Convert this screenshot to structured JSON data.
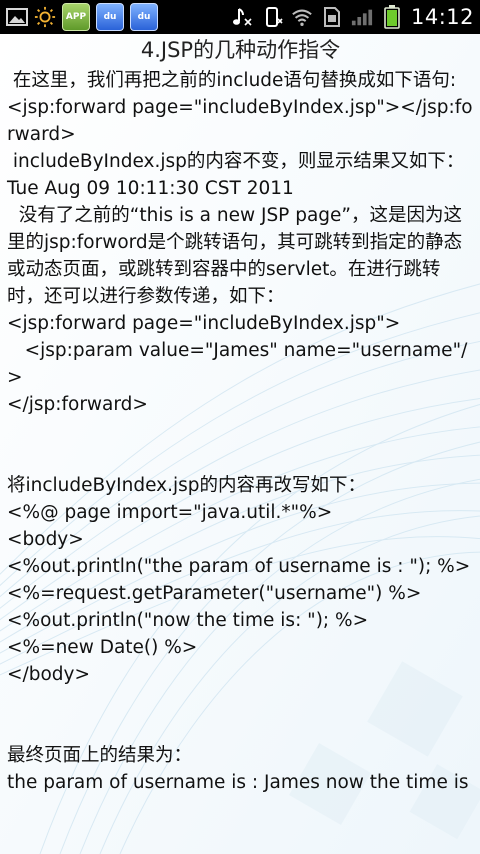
{
  "status_bar": {
    "time": "14:12",
    "left_icons": [
      {
        "icon": "gallery-icon"
      },
      {
        "icon": "brightness-icon"
      },
      {
        "icon": "app-store-icon",
        "label": "APP"
      },
      {
        "icon": "baidu-icon",
        "label": "du"
      },
      {
        "icon": "baidu-icon",
        "label": "du"
      }
    ],
    "right_icons": [
      "music-icon",
      "vibrate-icon",
      "wifi-icon",
      "sim-icon",
      "signal-icon",
      "battery-icon"
    ]
  },
  "article": {
    "title": "4.JSP的几种动作指令",
    "p1": " 在这里，我们再把之前的include语句替换成如下语句:",
    "code1": "<jsp:forward page=\"includeByIndex.jsp\"></jsp:forward>",
    "p2": " includeByIndex.jsp的内容不变，则显示结果又如下：",
    "date_line": "Tue Aug 09 10:11:30 CST 2011",
    "p3": "  没有了之前的“this is a new JSP page”，这是因为这里的jsp:forword是个跳转语句，其可跳转到指定的静态或动态页面，或跳转到容器中的servlet。在进行跳转时，还可以进行参数传递，如下：",
    "code2_l1": "<jsp:forward page=\"includeByIndex.jsp\">",
    "code2_l2": "   <jsp:param value=\"James\" name=\"username\"/>",
    "code2_l3": "</jsp:forward>",
    "p4": "将includeByIndex.jsp的内容再改写如下：",
    "code3": [
      "<%@ page import=\"java.util.*\"%>",
      "<body>",
      "<%out.println(\"the param of username is : \"); %>",
      "<%=request.getParameter(\"username\") %>",
      "<%out.println(\"now the time is: \"); %>",
      "<%=new Date() %>",
      "</body>"
    ],
    "p5": "最终页面上的结果为：",
    "result": "the param of username is : James now the time is"
  }
}
